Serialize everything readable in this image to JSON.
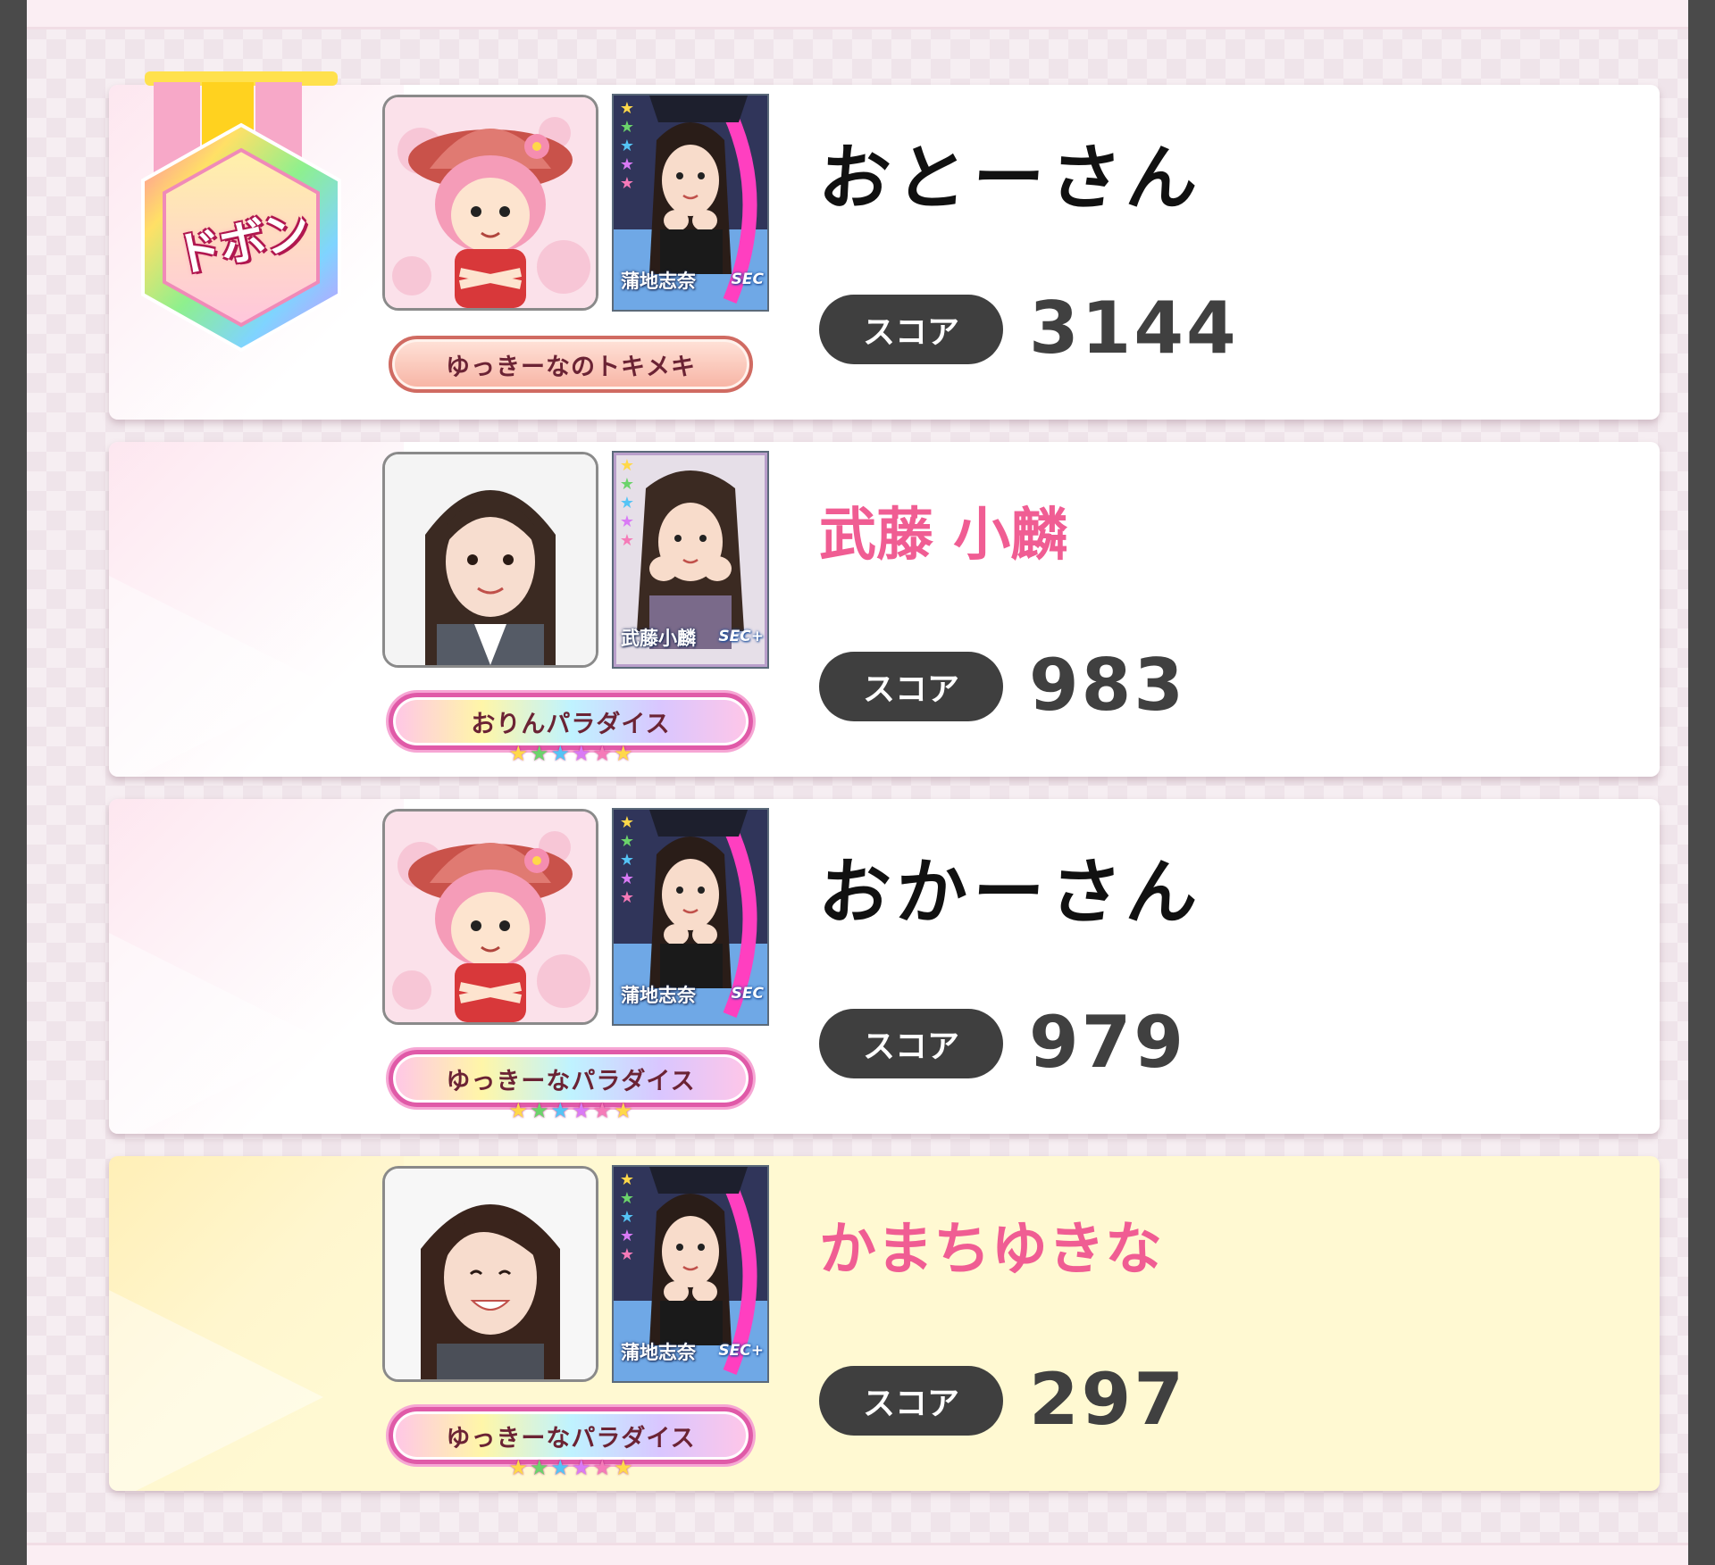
{
  "score_label": "スコア",
  "medal": {
    "label": "ドボン",
    "icon": "dobon-medal-icon"
  },
  "players": [
    {
      "name": "おとーさん",
      "name_style": "handwritten",
      "avatar": "mascot-avatar",
      "card": {
        "member": "蒲地志奈",
        "rarity": "SEC",
        "stars": 5
      },
      "title": "ゆっきーなのトキメキ",
      "title_style": "plain",
      "title_stars": 0,
      "score": "3144",
      "highlight": false
    },
    {
      "name": "武藤 小麟",
      "name_style": "pink",
      "avatar": "member-photo-avatar",
      "card": {
        "member": "武藤小麟",
        "rarity": "SEC+",
        "stars": 5
      },
      "title": "おりんパラダイス",
      "title_style": "rainbow",
      "title_stars": 6,
      "score": "983",
      "highlight": false
    },
    {
      "name": "おかーさん",
      "name_style": "handwritten",
      "avatar": "mascot-avatar",
      "card": {
        "member": "蒲地志奈",
        "rarity": "SEC",
        "stars": 5
      },
      "title": "ゆっきーなパラダイス",
      "title_style": "rainbow",
      "title_stars": 6,
      "score": "979",
      "highlight": false
    },
    {
      "name": "かまちゆきな",
      "name_style": "pink",
      "avatar": "member-photo-avatar",
      "card": {
        "member": "蒲地志奈",
        "rarity": "SEC+",
        "stars": 5
      },
      "title": "ゆっきーなパラダイス",
      "title_style": "rainbow",
      "title_stars": 6,
      "score": "297",
      "highlight": true
    }
  ],
  "colors": {
    "name_pink": "#f05d93",
    "score_pill": "#3f3f3f",
    "score_text": "#404040",
    "highlight_card": "#fff9d2"
  }
}
